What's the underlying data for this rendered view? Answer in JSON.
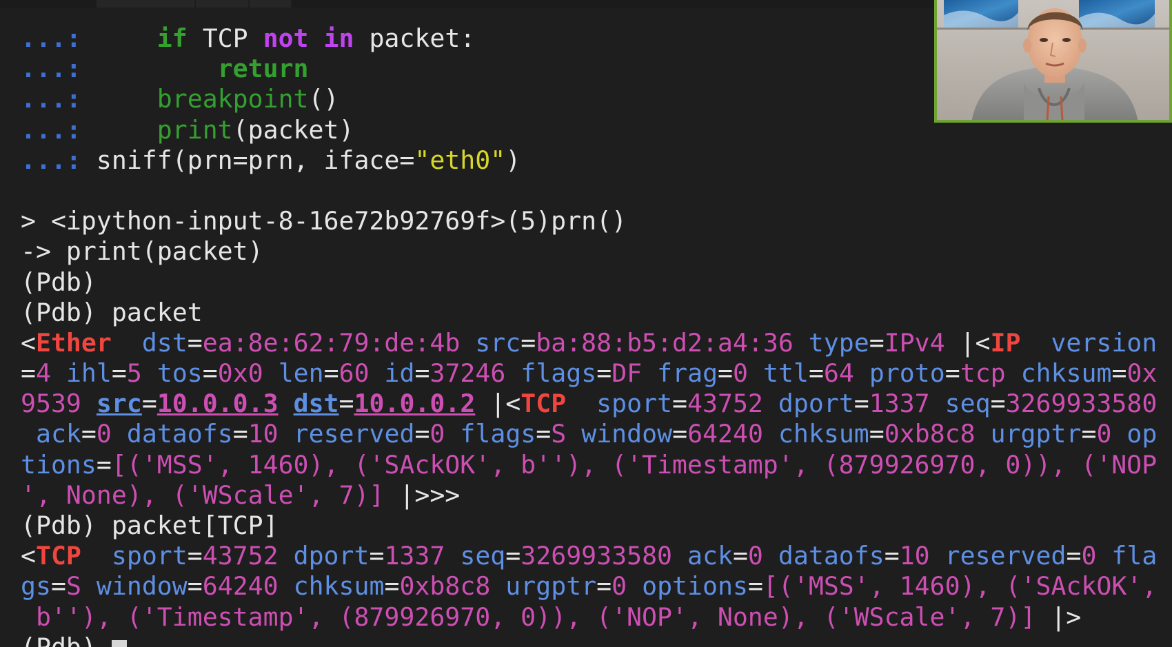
{
  "window": {
    "title": ""
  },
  "terminal": {
    "lines": [
      {
        "id": "line-1",
        "tokens": [
          {
            "cls": "tok-prompt",
            "text": "...:"
          },
          {
            "cls": "ws",
            "text": "     "
          },
          {
            "cls": "tok-kw",
            "text": "if"
          },
          {
            "cls": "tok-text",
            "text": " TCP "
          },
          {
            "cls": "tok-kw-purple",
            "text": "not"
          },
          {
            "cls": "tok-text",
            "text": " "
          },
          {
            "cls": "tok-kw-purple",
            "text": "in"
          },
          {
            "cls": "tok-text",
            "text": " packet:"
          }
        ]
      },
      {
        "id": "line-2",
        "tokens": [
          {
            "cls": "tok-prompt",
            "text": "...:"
          },
          {
            "cls": "ws",
            "text": "         "
          },
          {
            "cls": "tok-kw",
            "text": "return"
          }
        ]
      },
      {
        "id": "line-3",
        "tokens": [
          {
            "cls": "tok-prompt",
            "text": "...:"
          },
          {
            "cls": "ws",
            "text": "     "
          },
          {
            "cls": "tok-builtin",
            "text": "breakpoint"
          },
          {
            "cls": "tok-text",
            "text": "()"
          }
        ]
      },
      {
        "id": "line-4",
        "tokens": [
          {
            "cls": "tok-prompt",
            "text": "...:"
          },
          {
            "cls": "ws",
            "text": "     "
          },
          {
            "cls": "tok-builtin",
            "text": "print"
          },
          {
            "cls": "tok-text",
            "text": "(packet)"
          }
        ]
      },
      {
        "id": "line-5",
        "tokens": [
          {
            "cls": "tok-prompt",
            "text": "...:"
          },
          {
            "cls": "tok-text",
            "text": " sniff(prn=prn, iface="
          },
          {
            "cls": "tok-string",
            "text": "\"eth0\""
          },
          {
            "cls": "tok-text",
            "text": ")"
          }
        ]
      },
      {
        "id": "line-6",
        "tokens": [
          {
            "cls": "tok-text",
            "text": ""
          }
        ]
      },
      {
        "id": "line-7",
        "tokens": [
          {
            "cls": "tok-text",
            "text": "> <ipython-input-8-16e72b92769f>(5)prn()"
          }
        ]
      },
      {
        "id": "line-8",
        "tokens": [
          {
            "cls": "tok-text",
            "text": "-> print(packet)"
          }
        ]
      },
      {
        "id": "line-9",
        "tokens": [
          {
            "cls": "tok-text",
            "text": "(Pdb)"
          }
        ]
      },
      {
        "id": "line-10",
        "tokens": [
          {
            "cls": "tok-text",
            "text": "(Pdb) packet"
          }
        ]
      },
      {
        "id": "line-11",
        "tokens": [
          {
            "cls": "tok-sym",
            "text": "<"
          },
          {
            "cls": "tok-layer",
            "text": "Ether"
          },
          {
            "cls": "tok-text",
            "text": "  "
          },
          {
            "cls": "tok-field",
            "text": "dst"
          },
          {
            "cls": "tok-sym",
            "text": "="
          },
          {
            "cls": "tok-value",
            "text": "ea:8e:62:79:de:4b"
          },
          {
            "cls": "tok-text",
            "text": " "
          },
          {
            "cls": "tok-field",
            "text": "src"
          },
          {
            "cls": "tok-sym",
            "text": "="
          },
          {
            "cls": "tok-value",
            "text": "ba:88:b5:d2:a4:36"
          },
          {
            "cls": "tok-text",
            "text": " "
          },
          {
            "cls": "tok-field",
            "text": "type"
          },
          {
            "cls": "tok-sym",
            "text": "="
          },
          {
            "cls": "tok-value",
            "text": "IPv4"
          },
          {
            "cls": "tok-text",
            "text": " |<"
          },
          {
            "cls": "tok-layer",
            "text": "IP"
          },
          {
            "cls": "tok-text",
            "text": "  "
          },
          {
            "cls": "tok-field",
            "text": "version"
          }
        ]
      },
      {
        "id": "line-12",
        "tokens": [
          {
            "cls": "tok-sym",
            "text": "="
          },
          {
            "cls": "tok-value",
            "text": "4"
          },
          {
            "cls": "tok-text",
            "text": " "
          },
          {
            "cls": "tok-field",
            "text": "ihl"
          },
          {
            "cls": "tok-sym",
            "text": "="
          },
          {
            "cls": "tok-value",
            "text": "5"
          },
          {
            "cls": "tok-text",
            "text": " "
          },
          {
            "cls": "tok-field",
            "text": "tos"
          },
          {
            "cls": "tok-sym",
            "text": "="
          },
          {
            "cls": "tok-value",
            "text": "0x0"
          },
          {
            "cls": "tok-text",
            "text": " "
          },
          {
            "cls": "tok-field",
            "text": "len"
          },
          {
            "cls": "tok-sym",
            "text": "="
          },
          {
            "cls": "tok-value",
            "text": "60"
          },
          {
            "cls": "tok-text",
            "text": " "
          },
          {
            "cls": "tok-field",
            "text": "id"
          },
          {
            "cls": "tok-sym",
            "text": "="
          },
          {
            "cls": "tok-value",
            "text": "37246"
          },
          {
            "cls": "tok-text",
            "text": " "
          },
          {
            "cls": "tok-field",
            "text": "flags"
          },
          {
            "cls": "tok-sym",
            "text": "="
          },
          {
            "cls": "tok-value",
            "text": "DF"
          },
          {
            "cls": "tok-text",
            "text": " "
          },
          {
            "cls": "tok-field",
            "text": "frag"
          },
          {
            "cls": "tok-sym",
            "text": "="
          },
          {
            "cls": "tok-value",
            "text": "0"
          },
          {
            "cls": "tok-text",
            "text": " "
          },
          {
            "cls": "tok-field",
            "text": "ttl"
          },
          {
            "cls": "tok-sym",
            "text": "="
          },
          {
            "cls": "tok-value",
            "text": "64"
          },
          {
            "cls": "tok-text",
            "text": " "
          },
          {
            "cls": "tok-field",
            "text": "proto"
          },
          {
            "cls": "tok-sym",
            "text": "="
          },
          {
            "cls": "tok-value",
            "text": "tcp"
          },
          {
            "cls": "tok-text",
            "text": " "
          },
          {
            "cls": "tok-field",
            "text": "chksum"
          },
          {
            "cls": "tok-sym",
            "text": "="
          },
          {
            "cls": "tok-value",
            "text": "0x"
          }
        ]
      },
      {
        "id": "line-13",
        "tokens": [
          {
            "cls": "tok-value",
            "text": "9539"
          },
          {
            "cls": "tok-text",
            "text": " "
          },
          {
            "cls": "tok-addr-field",
            "text": "src"
          },
          {
            "cls": "tok-sym",
            "text": "="
          },
          {
            "cls": "tok-addr",
            "text": "10.0.0.3"
          },
          {
            "cls": "tok-text",
            "text": " "
          },
          {
            "cls": "tok-addr-field",
            "text": "dst"
          },
          {
            "cls": "tok-sym",
            "text": "="
          },
          {
            "cls": "tok-addr",
            "text": "10.0.0.2"
          },
          {
            "cls": "tok-text",
            "text": " |<"
          },
          {
            "cls": "tok-layer",
            "text": "TCP"
          },
          {
            "cls": "tok-text",
            "text": "  "
          },
          {
            "cls": "tok-field",
            "text": "sport"
          },
          {
            "cls": "tok-sym",
            "text": "="
          },
          {
            "cls": "tok-value",
            "text": "43752"
          },
          {
            "cls": "tok-text",
            "text": " "
          },
          {
            "cls": "tok-field",
            "text": "dport"
          },
          {
            "cls": "tok-sym",
            "text": "="
          },
          {
            "cls": "tok-value",
            "text": "1337"
          },
          {
            "cls": "tok-text",
            "text": " "
          },
          {
            "cls": "tok-field",
            "text": "seq"
          },
          {
            "cls": "tok-sym",
            "text": "="
          },
          {
            "cls": "tok-value",
            "text": "3269933580"
          }
        ]
      },
      {
        "id": "line-14",
        "tokens": [
          {
            "cls": "tok-text",
            "text": " "
          },
          {
            "cls": "tok-field",
            "text": "ack"
          },
          {
            "cls": "tok-sym",
            "text": "="
          },
          {
            "cls": "tok-value",
            "text": "0"
          },
          {
            "cls": "tok-text",
            "text": " "
          },
          {
            "cls": "tok-field",
            "text": "dataofs"
          },
          {
            "cls": "tok-sym",
            "text": "="
          },
          {
            "cls": "tok-value",
            "text": "10"
          },
          {
            "cls": "tok-text",
            "text": " "
          },
          {
            "cls": "tok-field",
            "text": "reserved"
          },
          {
            "cls": "tok-sym",
            "text": "="
          },
          {
            "cls": "tok-value",
            "text": "0"
          },
          {
            "cls": "tok-text",
            "text": " "
          },
          {
            "cls": "tok-field",
            "text": "flags"
          },
          {
            "cls": "tok-sym",
            "text": "="
          },
          {
            "cls": "tok-value",
            "text": "S"
          },
          {
            "cls": "tok-text",
            "text": " "
          },
          {
            "cls": "tok-field",
            "text": "window"
          },
          {
            "cls": "tok-sym",
            "text": "="
          },
          {
            "cls": "tok-value",
            "text": "64240"
          },
          {
            "cls": "tok-text",
            "text": " "
          },
          {
            "cls": "tok-field",
            "text": "chksum"
          },
          {
            "cls": "tok-sym",
            "text": "="
          },
          {
            "cls": "tok-value",
            "text": "0xb8c8"
          },
          {
            "cls": "tok-text",
            "text": " "
          },
          {
            "cls": "tok-field",
            "text": "urgptr"
          },
          {
            "cls": "tok-sym",
            "text": "="
          },
          {
            "cls": "tok-value",
            "text": "0"
          },
          {
            "cls": "tok-text",
            "text": " "
          },
          {
            "cls": "tok-field",
            "text": "op"
          }
        ]
      },
      {
        "id": "line-15",
        "tokens": [
          {
            "cls": "tok-field",
            "text": "tions"
          },
          {
            "cls": "tok-sym",
            "text": "="
          },
          {
            "cls": "tok-value",
            "text": "[('MSS', 1460), ('SAckOK', b''), ('Timestamp', (879926970, 0)), ('NOP"
          }
        ]
      },
      {
        "id": "line-16",
        "tokens": [
          {
            "cls": "tok-value",
            "text": "', None), ('WScale', 7)]"
          },
          {
            "cls": "tok-text",
            "text": " |>>>"
          }
        ]
      },
      {
        "id": "line-17",
        "tokens": [
          {
            "cls": "tok-text",
            "text": "(Pdb) packet[TCP]"
          }
        ]
      },
      {
        "id": "line-18",
        "tokens": [
          {
            "cls": "tok-sym",
            "text": "<"
          },
          {
            "cls": "tok-layer",
            "text": "TCP"
          },
          {
            "cls": "tok-text",
            "text": "  "
          },
          {
            "cls": "tok-field",
            "text": "sport"
          },
          {
            "cls": "tok-sym",
            "text": "="
          },
          {
            "cls": "tok-value",
            "text": "43752"
          },
          {
            "cls": "tok-text",
            "text": " "
          },
          {
            "cls": "tok-field",
            "text": "dport"
          },
          {
            "cls": "tok-sym",
            "text": "="
          },
          {
            "cls": "tok-value",
            "text": "1337"
          },
          {
            "cls": "tok-text",
            "text": " "
          },
          {
            "cls": "tok-field",
            "text": "seq"
          },
          {
            "cls": "tok-sym",
            "text": "="
          },
          {
            "cls": "tok-value",
            "text": "3269933580"
          },
          {
            "cls": "tok-text",
            "text": " "
          },
          {
            "cls": "tok-field",
            "text": "ack"
          },
          {
            "cls": "tok-sym",
            "text": "="
          },
          {
            "cls": "tok-value",
            "text": "0"
          },
          {
            "cls": "tok-text",
            "text": " "
          },
          {
            "cls": "tok-field",
            "text": "dataofs"
          },
          {
            "cls": "tok-sym",
            "text": "="
          },
          {
            "cls": "tok-value",
            "text": "10"
          },
          {
            "cls": "tok-text",
            "text": " "
          },
          {
            "cls": "tok-field",
            "text": "reserved"
          },
          {
            "cls": "tok-sym",
            "text": "="
          },
          {
            "cls": "tok-value",
            "text": "0"
          },
          {
            "cls": "tok-text",
            "text": " "
          },
          {
            "cls": "tok-field",
            "text": "fla"
          }
        ]
      },
      {
        "id": "line-19",
        "tokens": [
          {
            "cls": "tok-field",
            "text": "gs"
          },
          {
            "cls": "tok-sym",
            "text": "="
          },
          {
            "cls": "tok-value",
            "text": "S"
          },
          {
            "cls": "tok-text",
            "text": " "
          },
          {
            "cls": "tok-field",
            "text": "window"
          },
          {
            "cls": "tok-sym",
            "text": "="
          },
          {
            "cls": "tok-value",
            "text": "64240"
          },
          {
            "cls": "tok-text",
            "text": " "
          },
          {
            "cls": "tok-field",
            "text": "chksum"
          },
          {
            "cls": "tok-sym",
            "text": "="
          },
          {
            "cls": "tok-value",
            "text": "0xb8c8"
          },
          {
            "cls": "tok-text",
            "text": " "
          },
          {
            "cls": "tok-field",
            "text": "urgptr"
          },
          {
            "cls": "tok-sym",
            "text": "="
          },
          {
            "cls": "tok-value",
            "text": "0"
          },
          {
            "cls": "tok-text",
            "text": " "
          },
          {
            "cls": "tok-field",
            "text": "options"
          },
          {
            "cls": "tok-sym",
            "text": "="
          },
          {
            "cls": "tok-value",
            "text": "[('MSS', 1460), ('SAckOK',"
          }
        ]
      },
      {
        "id": "line-20",
        "tokens": [
          {
            "cls": "tok-value",
            "text": " b''), ('Timestamp', (879926970, 0)), ('NOP', None), ('WScale', 7)]"
          },
          {
            "cls": "tok-text",
            "text": " |>"
          }
        ]
      },
      {
        "id": "line-21",
        "tokens": [
          {
            "cls": "tok-text",
            "text": "(Pdb) "
          }
        ],
        "cursor": true
      }
    ]
  },
  "colors": {
    "background": "#1e1e1e",
    "prompt": "#3f6fd1",
    "keyword_green": "#34a030",
    "keyword_purple": "#c043f0",
    "string_yellow": "#d8d82a",
    "field_blue": "#5d8fe4",
    "value_magenta": "#cd4fb3",
    "layer_red": "#f0463f",
    "webcam_border": "#6fa434"
  },
  "webcam": {
    "icon": "webcam-presenter"
  }
}
